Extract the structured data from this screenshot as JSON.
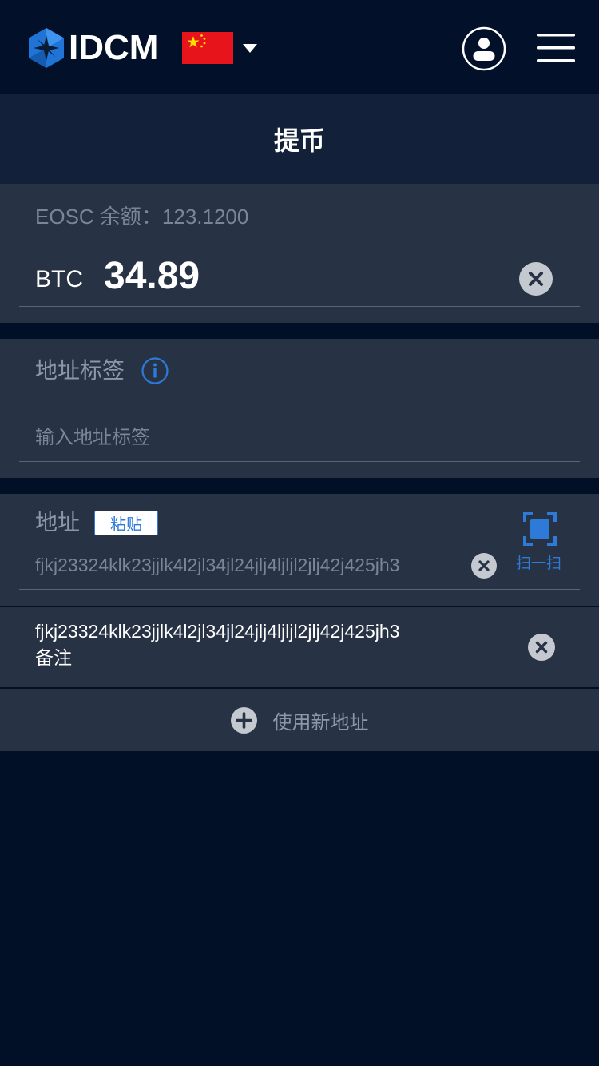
{
  "header": {
    "brand": "IDCM",
    "icons": {
      "logo": "hexagon-star-logo",
      "flag": "china-flag-icon",
      "dropdown": "chevron-down-icon",
      "user": "user-icon",
      "menu": "menu-icon"
    }
  },
  "page": {
    "title": "提币"
  },
  "amount": {
    "balance_text": "EOSC 余额：123.1200",
    "currency": "BTC",
    "value": "34.89"
  },
  "address_label": {
    "title": "地址标签",
    "placeholder": "输入地址标签"
  },
  "address": {
    "title": "地址",
    "paste_label": "粘贴",
    "value": "fjkj23324klk23jjlk4l2jl34jl24jlj4ljljl2jlj42j425jh3",
    "scan_label": "扫一扫"
  },
  "saved_address": {
    "address": "fjkj23324klk23jjlk4l2jl34jl24jlj4ljljl2jlj42j425jh3",
    "note": "备注"
  },
  "new_address": {
    "label": "使用新地址"
  },
  "colors": {
    "background": "#011027",
    "card": "#273244",
    "title_bar": "#13203a",
    "accent": "#2e7ad8",
    "muted_text": "#7c8595"
  }
}
